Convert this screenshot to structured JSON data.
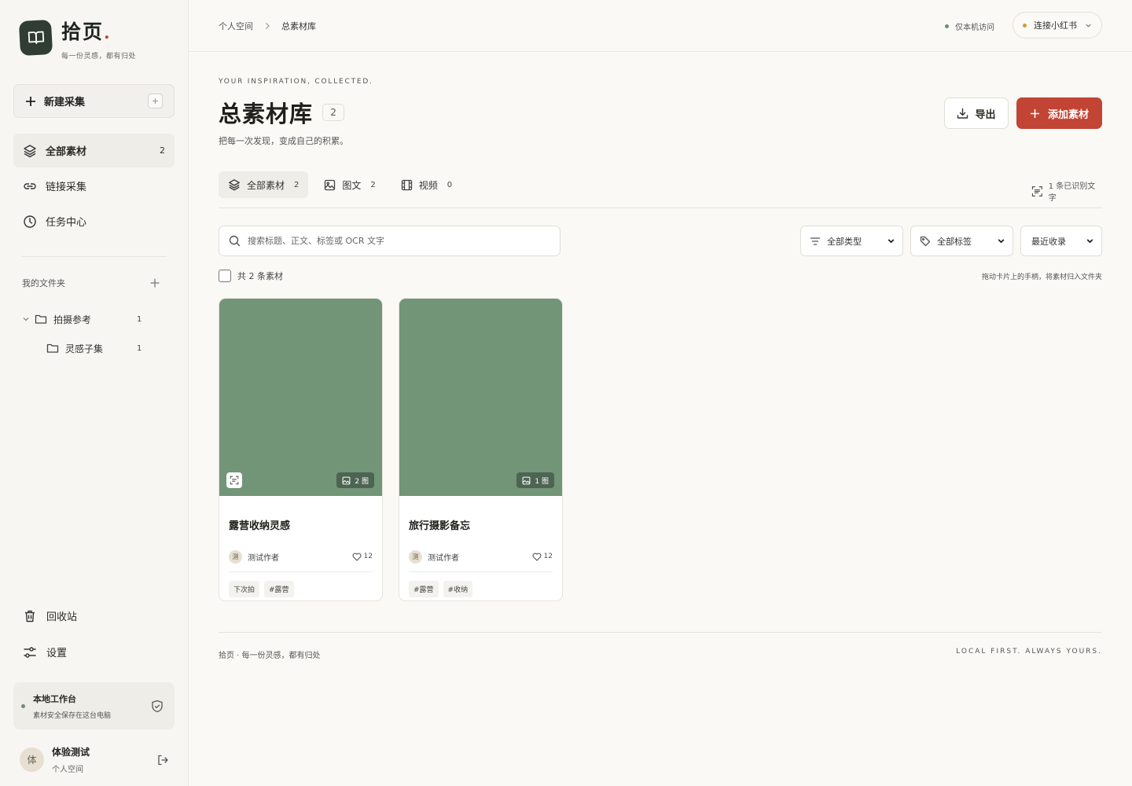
{
  "brand": {
    "name": "拾页",
    "dot": ".",
    "tagline": "每一份灵感，都有归处"
  },
  "sidebar": {
    "new_capture": "新建采集",
    "new_capture_kbd": "+",
    "nav": [
      {
        "label": "全部素材",
        "count": "2",
        "icon": "layers-icon",
        "active": true
      },
      {
        "label": "链接采集",
        "count": "",
        "icon": "link-icon",
        "active": false
      },
      {
        "label": "任务中心",
        "count": "",
        "icon": "clock-icon",
        "active": false
      }
    ],
    "folders_title": "我的文件夹",
    "folders": [
      {
        "label": "拍摄参考",
        "count": "1",
        "expanded": true
      },
      {
        "label": "灵感子集",
        "count": "1"
      }
    ],
    "trash": "回收站",
    "settings": "设置",
    "local": {
      "title": "本地工作台",
      "subtitle": "素材安全保存在这台电脑"
    },
    "user": {
      "avatar": "体",
      "name": "体验测试",
      "space": "个人空间"
    }
  },
  "topbar": {
    "breadcrumb": [
      "个人空间",
      "总素材库"
    ],
    "local_access": "仅本机访问",
    "connect": "连接小红书"
  },
  "page": {
    "eyebrow": "YOUR INSPIRATION, COLLECTED.",
    "title": "总素材库",
    "count": "2",
    "description": "把每一次发现，变成自己的积累。",
    "export": "导出",
    "add": "添加素材"
  },
  "tabs": [
    {
      "label": "全部素材",
      "count": "2",
      "icon": "layers-icon",
      "active": true
    },
    {
      "label": "图文",
      "count": "2",
      "icon": "image-icon",
      "active": false
    },
    {
      "label": "视频",
      "count": "0",
      "icon": "film-icon",
      "active": false
    }
  ],
  "ocr_info": "1 条已识别文字",
  "search": {
    "placeholder": "搜索标题、正文、标签或 OCR 文字",
    "value": ""
  },
  "filters": {
    "type": "全部类型",
    "tags": "全部标签",
    "sort": "最近收录"
  },
  "select_all": "共 2 条素材",
  "drag_hint": "拖动卡片上的手柄，将素材归入文件夹",
  "cards": [
    {
      "title": "露营收纳灵感",
      "images": "2 图",
      "author_avatar": "测",
      "author": "测试作者",
      "likes": "12",
      "tags": [
        "下次拍",
        "#露营"
      ],
      "has_ocr": true,
      "cover_color": "#729477"
    },
    {
      "title": "旅行摄影备忘",
      "images": "1 图",
      "author_avatar": "测",
      "author": "测试作者",
      "likes": "12",
      "tags": [
        "#露营",
        "#收纳"
      ],
      "has_ocr": false,
      "cover_color": "#729477"
    }
  ],
  "footer": {
    "left": "拾页 · 每一份灵感，都有归处",
    "right": "LOCAL FIRST. ALWAYS YOURS."
  },
  "colors": {
    "accent": "#c24434",
    "brand_dark": "#2f3d33",
    "cover": "#729477",
    "status_green": "#6b8f6c",
    "status_amber": "#d49a3a"
  }
}
